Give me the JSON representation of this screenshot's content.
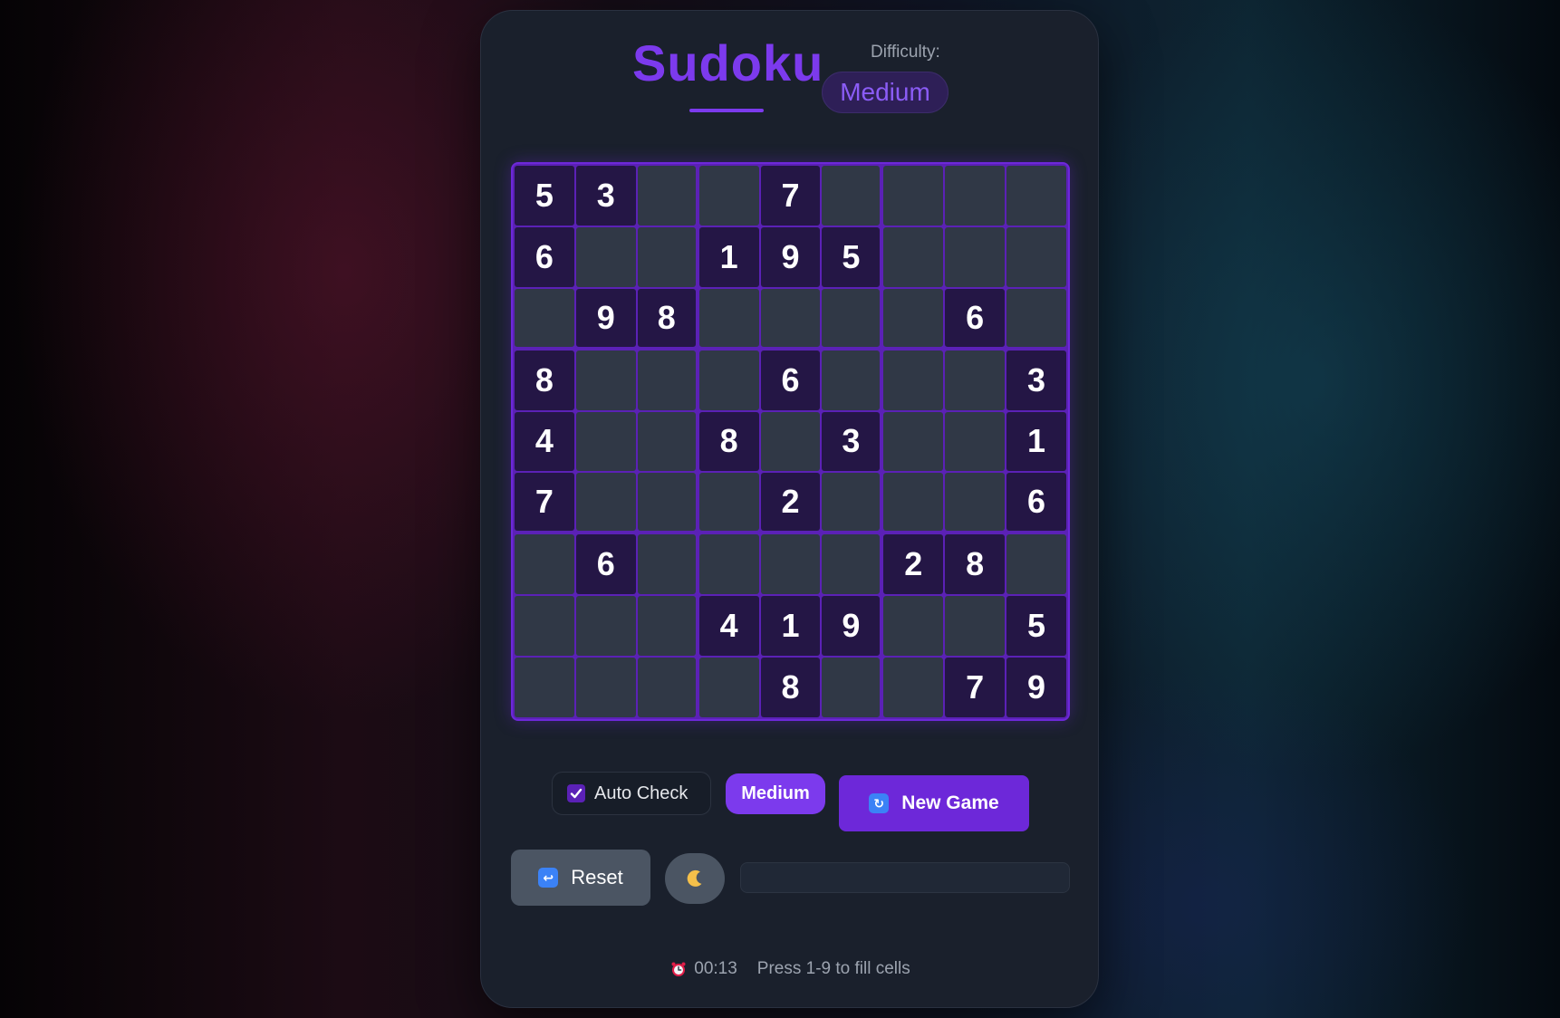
{
  "header": {
    "title": "Sudoku",
    "difficulty_label": "Difficulty:",
    "difficulty_value": "Medium"
  },
  "board": [
    [
      5,
      3,
      null,
      null,
      7,
      null,
      null,
      null,
      null
    ],
    [
      6,
      null,
      null,
      1,
      9,
      5,
      null,
      null,
      null
    ],
    [
      null,
      9,
      8,
      null,
      null,
      null,
      null,
      6,
      null
    ],
    [
      8,
      null,
      null,
      null,
      6,
      null,
      null,
      null,
      3
    ],
    [
      4,
      null,
      null,
      8,
      null,
      3,
      null,
      null,
      1
    ],
    [
      7,
      null,
      null,
      null,
      2,
      null,
      null,
      null,
      6
    ],
    [
      null,
      6,
      null,
      null,
      null,
      null,
      2,
      8,
      null
    ],
    [
      null,
      null,
      null,
      4,
      1,
      9,
      null,
      null,
      5
    ],
    [
      null,
      null,
      null,
      null,
      8,
      null,
      null,
      7,
      9
    ]
  ],
  "controls": {
    "auto_check_label": "Auto Check",
    "auto_check_checked": true,
    "difficulty_button": "Medium",
    "new_game_label": "New Game",
    "reset_label": "Reset",
    "theme_icon": "moon-icon"
  },
  "footer": {
    "timer_icon": "alarm-clock-icon",
    "timer": "00:13",
    "hint": "Press 1-9 to fill cells"
  },
  "colors": {
    "accent": "#7c3aed",
    "given_cell": "#241645",
    "empty_cell": "#303846",
    "card_bg": "#1a202c"
  }
}
